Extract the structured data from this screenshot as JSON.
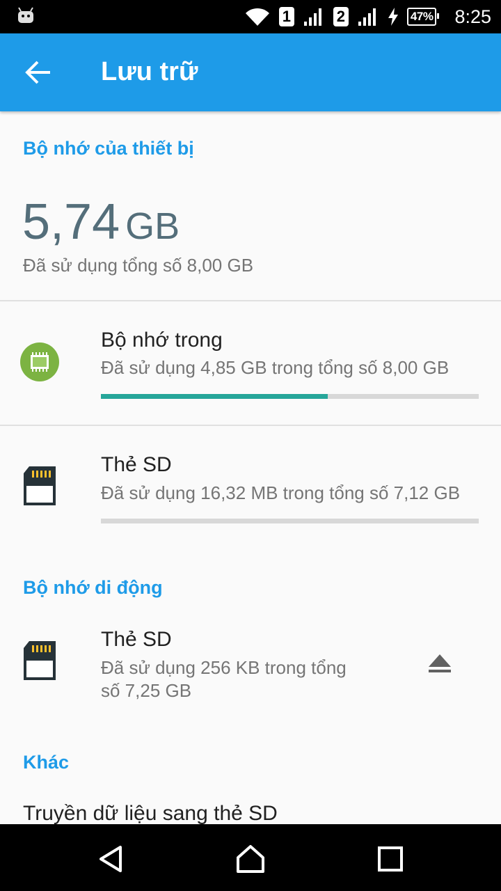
{
  "status_bar": {
    "sim1": "1",
    "sim2": "2",
    "battery": "47%",
    "time": "8:25"
  },
  "app_bar": {
    "title": "Lưu trữ"
  },
  "device_storage": {
    "header": "Bộ nhớ của thiết bị",
    "used_value": "5,74",
    "used_unit": "GB",
    "used_summary": "Đã sử dụng tổng số 8,00 GB",
    "items": [
      {
        "title": "Bộ nhớ trong",
        "subtitle": "Đã sử dụng 4,85 GB trong tổng số 8,00 GB",
        "used_fraction": 0.6
      },
      {
        "title": "Thẻ SD",
        "subtitle": "Đã sử dụng 16,32 MB trong tổng số 7,12 GB",
        "used_fraction": 0.0
      }
    ]
  },
  "portable_storage": {
    "header": "Bộ nhớ di động",
    "item": {
      "title": "Thẻ SD",
      "subtitle_line1": "Đã sử dụng 256 KB trong tổng",
      "subtitle_line2": "số 7,25 GB"
    }
  },
  "other": {
    "header": "Khác",
    "item": "Truyền dữ liệu sang thẻ SD"
  },
  "colors": {
    "accent": "#1e9be8",
    "progress": "#26a69a",
    "chip_green": "#7cb342"
  },
  "icons": [
    "android-icon",
    "wifi-icon",
    "signal-icon",
    "charging-icon",
    "back-arrow-icon",
    "chip-icon",
    "sd-card-icon",
    "eject-icon",
    "nav-back-icon",
    "nav-home-icon",
    "nav-recents-icon"
  ]
}
